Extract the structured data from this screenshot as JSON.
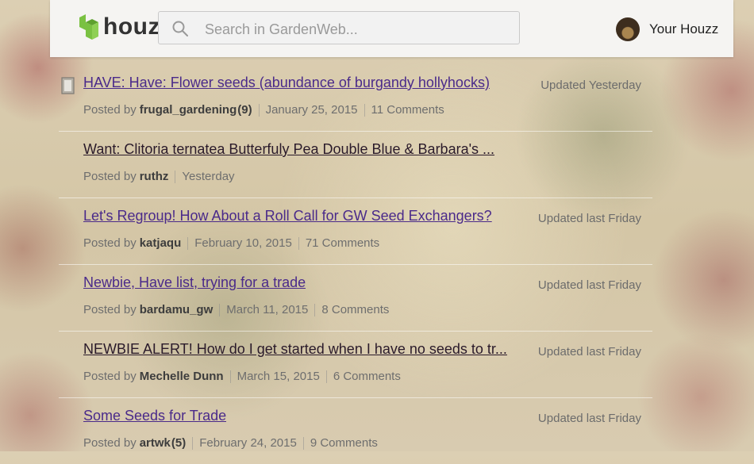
{
  "header": {
    "logo_text": "houzz",
    "search_placeholder": "Search in GardenWeb...",
    "user_label": "Your Houzz"
  },
  "colors": {
    "brand_green": "#7ac142",
    "link_purple": "#4a2a8a",
    "visited_dark": "#2a1a2a"
  },
  "threads": [
    {
      "title": "HAVE: Have: Flower seeds (abundance of burgandy hollyhocks)",
      "updated": "Updated Yesterday",
      "posted_by": "Posted by",
      "author": "frugal_gardening",
      "author_badge": "(9)",
      "date": "January 25, 2015",
      "comments": "11 Comments",
      "icon": "document-icon"
    },
    {
      "title": "Want: Clitoria ternatea Butterfuly Pea Double Blue & Barbara's ...",
      "updated": "",
      "posted_by": "Posted by",
      "author": "ruthz",
      "author_badge": "",
      "date": "Yesterday",
      "comments": ""
    },
    {
      "title": "Let's Regroup! How About a Roll Call for GW Seed Exchangers?",
      "updated": "Updated last Friday",
      "posted_by": "Posted by",
      "author": "katjaqu",
      "author_badge": "",
      "date": "February 10, 2015",
      "comments": "71 Comments"
    },
    {
      "title": "Newbie, Have list, trying for a trade",
      "updated": "Updated last Friday",
      "posted_by": "Posted by",
      "author": "bardamu_gw",
      "author_badge": "",
      "date": "March 11, 2015",
      "comments": "8 Comments"
    },
    {
      "title": "NEWBIE ALERT! How do I get started when I have no seeds to tr...",
      "updated": "Updated last Friday",
      "posted_by": "Posted by",
      "author": "Mechelle Dunn",
      "author_badge": "",
      "date": "March 15, 2015",
      "comments": "6 Comments"
    },
    {
      "title": "Some Seeds for Trade",
      "updated": "Updated last Friday",
      "posted_by": "Posted by",
      "author": "artwk",
      "author_badge": "(5)",
      "date": "February 24, 2015",
      "comments": "9 Comments"
    }
  ]
}
